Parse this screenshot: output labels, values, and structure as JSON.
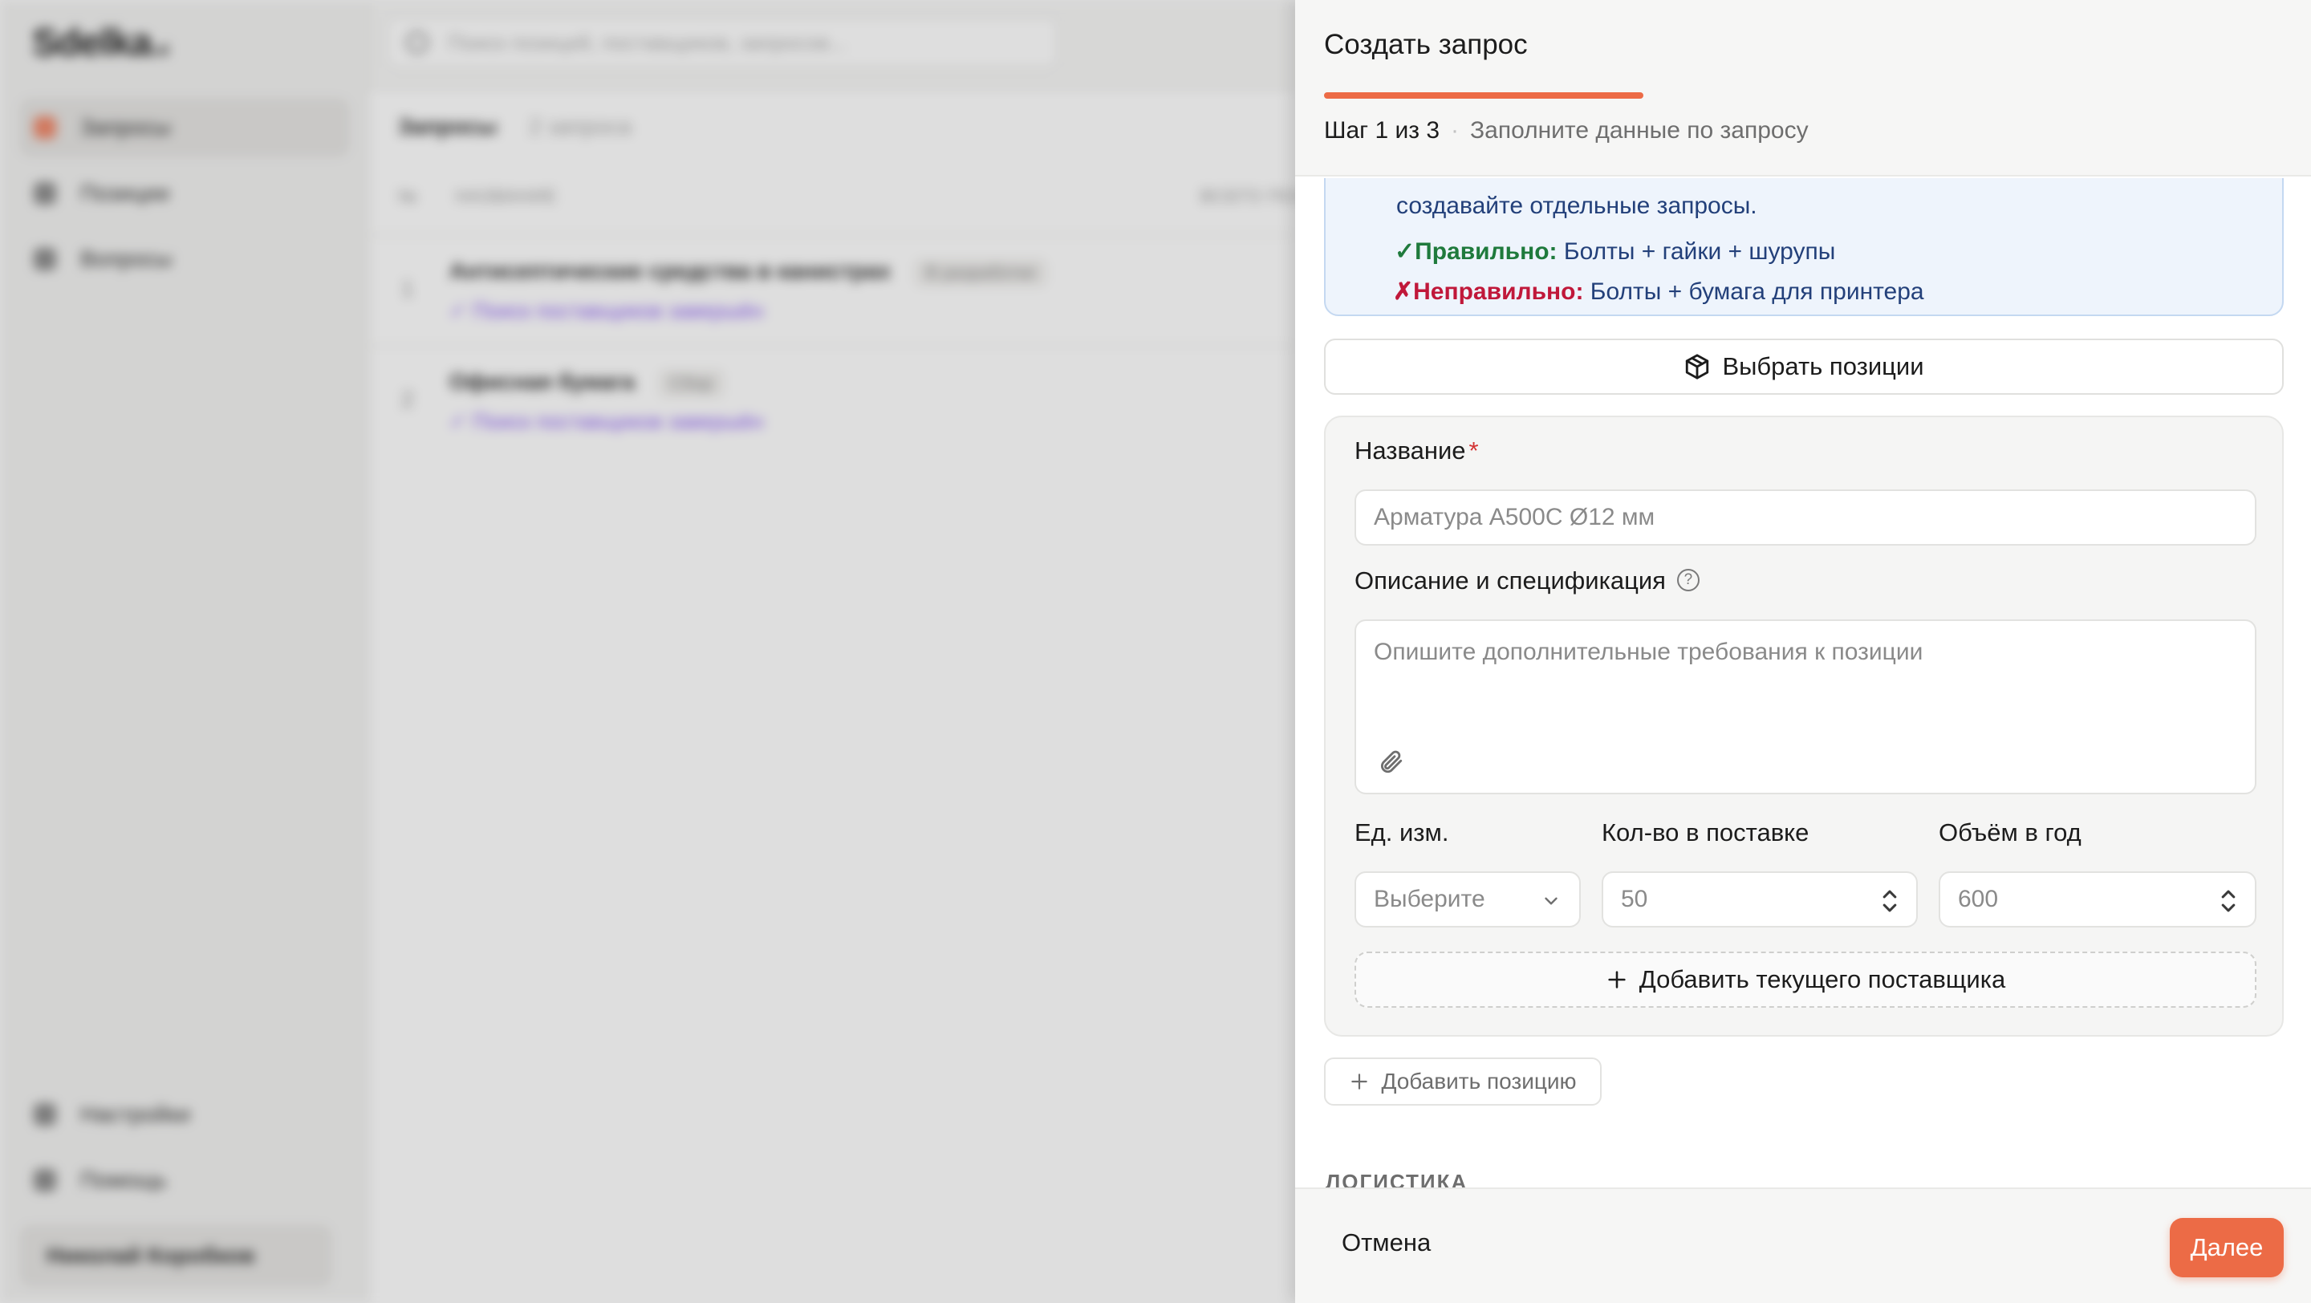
{
  "background": {
    "logo": "Sdelka",
    "logo_suffix": ".ai",
    "search_placeholder": "Поиск позиций, поставщиков, запросов...",
    "nav": [
      {
        "label": "Запросы"
      },
      {
        "label": "Позиции"
      },
      {
        "label": "Вопросы"
      }
    ],
    "nav_bottom": [
      {
        "label": "Настройки"
      },
      {
        "label": "Помощь"
      }
    ],
    "user": "Николай Коробков",
    "tab": "Запросы",
    "tab_count": "2 запроса",
    "col_num": "№",
    "col_name": "НАЗВАНИЕ",
    "col_total": "ВСЕГО ПОЗ",
    "rows": [
      {
        "num": "1",
        "title": "Антисептические средства в канистрах",
        "badge": "В разработке",
        "sub": "✓ Поиск поставщиков завершён"
      },
      {
        "num": "2",
        "title": "Офисная бумага",
        "badge": "Сбор",
        "sub": "✓ Поиск поставщиков завершён"
      }
    ]
  },
  "drawer": {
    "title": "Создать запрос",
    "progress": 0.333,
    "step": "Шаг 1 из 3",
    "step_sep": "·",
    "step_desc": "Заполните данные по запросу",
    "info": {
      "line1": "создавайте отдельные запросы.",
      "ok_mark": "✓",
      "ok_label": "Правильно:",
      "ok_text": " Болты + гайки + шурупы",
      "bad_mark": "✗",
      "bad_label": "Неправильно:",
      "bad_text": " Болты + бумага для принтера"
    },
    "pick_positions": "Выбрать позиции",
    "form": {
      "name_label": "Название",
      "required_mark": "*",
      "name_placeholder": "Арматура А500С Ø12 мм",
      "desc_label": "Описание и спецификация",
      "help": "?",
      "desc_placeholder": "Опишите дополнительные требования к позиции",
      "unit_label": "Ед. изм.",
      "unit_value": "Выберите",
      "qty_label": "Кол-во в поставке",
      "qty_value": "50",
      "year_label": "Объём в год",
      "year_value": "600",
      "add_supplier": "Добавить текущего поставщика"
    },
    "add_position": "Добавить позицию",
    "section_logistics": "ЛОГИСТИКА",
    "cancel": "Отмена",
    "next": "Далее"
  },
  "colors": {
    "accent": "#ec6b46",
    "info_bg": "#eef4fc",
    "ok": "#1f7a3c",
    "bad": "#c0183a"
  }
}
